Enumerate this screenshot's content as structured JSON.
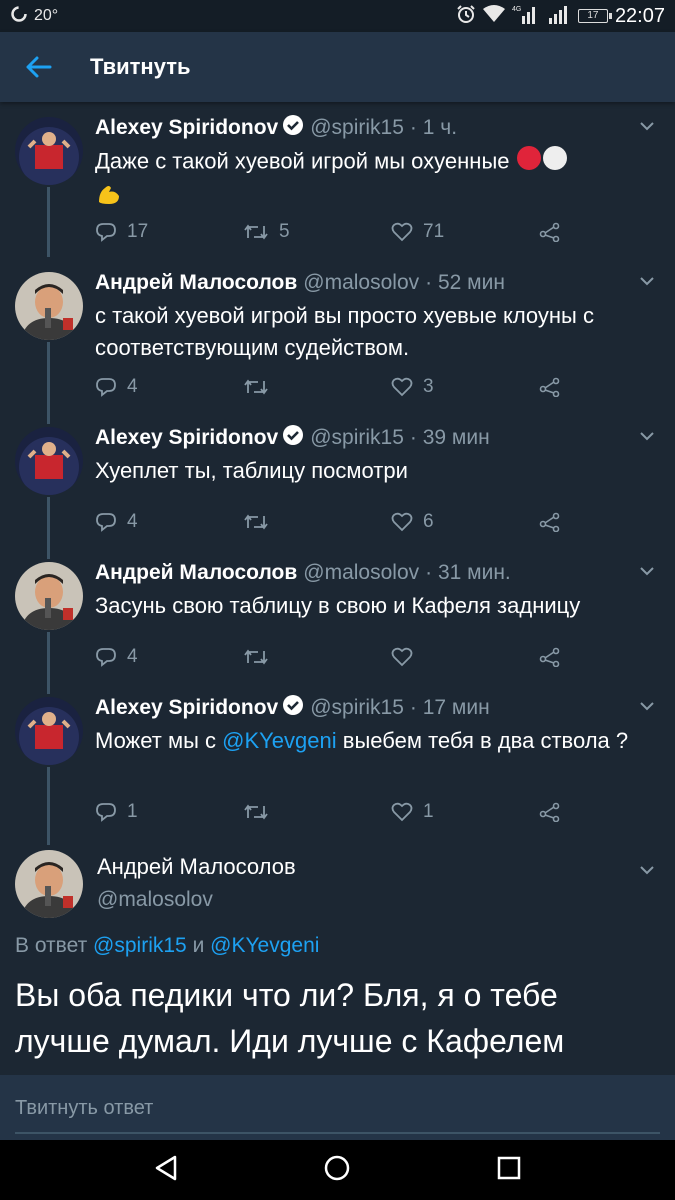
{
  "status_bar": {
    "temperature": "20°",
    "network": "4G",
    "battery": "17",
    "time": "22:07"
  },
  "app_bar": {
    "title": "Твитнуть"
  },
  "tweets": [
    {
      "name": "Alexey Spiridonov",
      "verified": true,
      "handle": "@spirik15",
      "time": "· 1 ч.",
      "text": "Даже с такой хуевой игрой мы охуенные",
      "replies": "17",
      "retweets": "5",
      "likes": "71"
    },
    {
      "name": "Андрей Малосолов",
      "verified": false,
      "handle": "@malosolov",
      "time": "· 52 мин",
      "text": "с такой хуевой игрой вы просто хуевые клоуны с соответствующим судейством.",
      "replies": "4",
      "retweets": "",
      "likes": "3"
    },
    {
      "name": "Alexey Spiridonov",
      "verified": true,
      "handle": "@spirik15",
      "time": "· 39 мин",
      "text": "Хуеплет ты, таблицу посмотри",
      "replies": "4",
      "retweets": "",
      "likes": "6"
    },
    {
      "name": "Андрей Малосолов",
      "verified": false,
      "handle": "@malosolov",
      "time": "· 31 мин.",
      "text": "Засунь свою таблицу в свою и Кафеля задницу",
      "replies": "4",
      "retweets": "",
      "likes": ""
    },
    {
      "name": "Alexey Spiridonov",
      "verified": true,
      "handle": "@spirik15",
      "time": "· 17 мин",
      "text_before": "Может мы с ",
      "mention": "@KYevgeni",
      "text_after": " выебем тебя в два ствола ?",
      "replies": "1",
      "retweets": "",
      "likes": "1"
    }
  ],
  "main_tweet": {
    "name": "Андрей Малосолов",
    "handle": "@malosolov",
    "reply_prefix": "В ответ ",
    "reply_mention1": "@spirik15",
    "reply_and": " и ",
    "reply_mention2": "@KYevgeni",
    "text": "Вы оба педики что ли? Бля, я  о тебе лучше думал. Иди лучше с Кафелем"
  },
  "compose": {
    "placeholder": "Твитнуть ответ"
  },
  "colors": {
    "background": "#1c2733",
    "appbar": "#243447",
    "accent": "#1da1f2",
    "muted": "#8899a6"
  }
}
